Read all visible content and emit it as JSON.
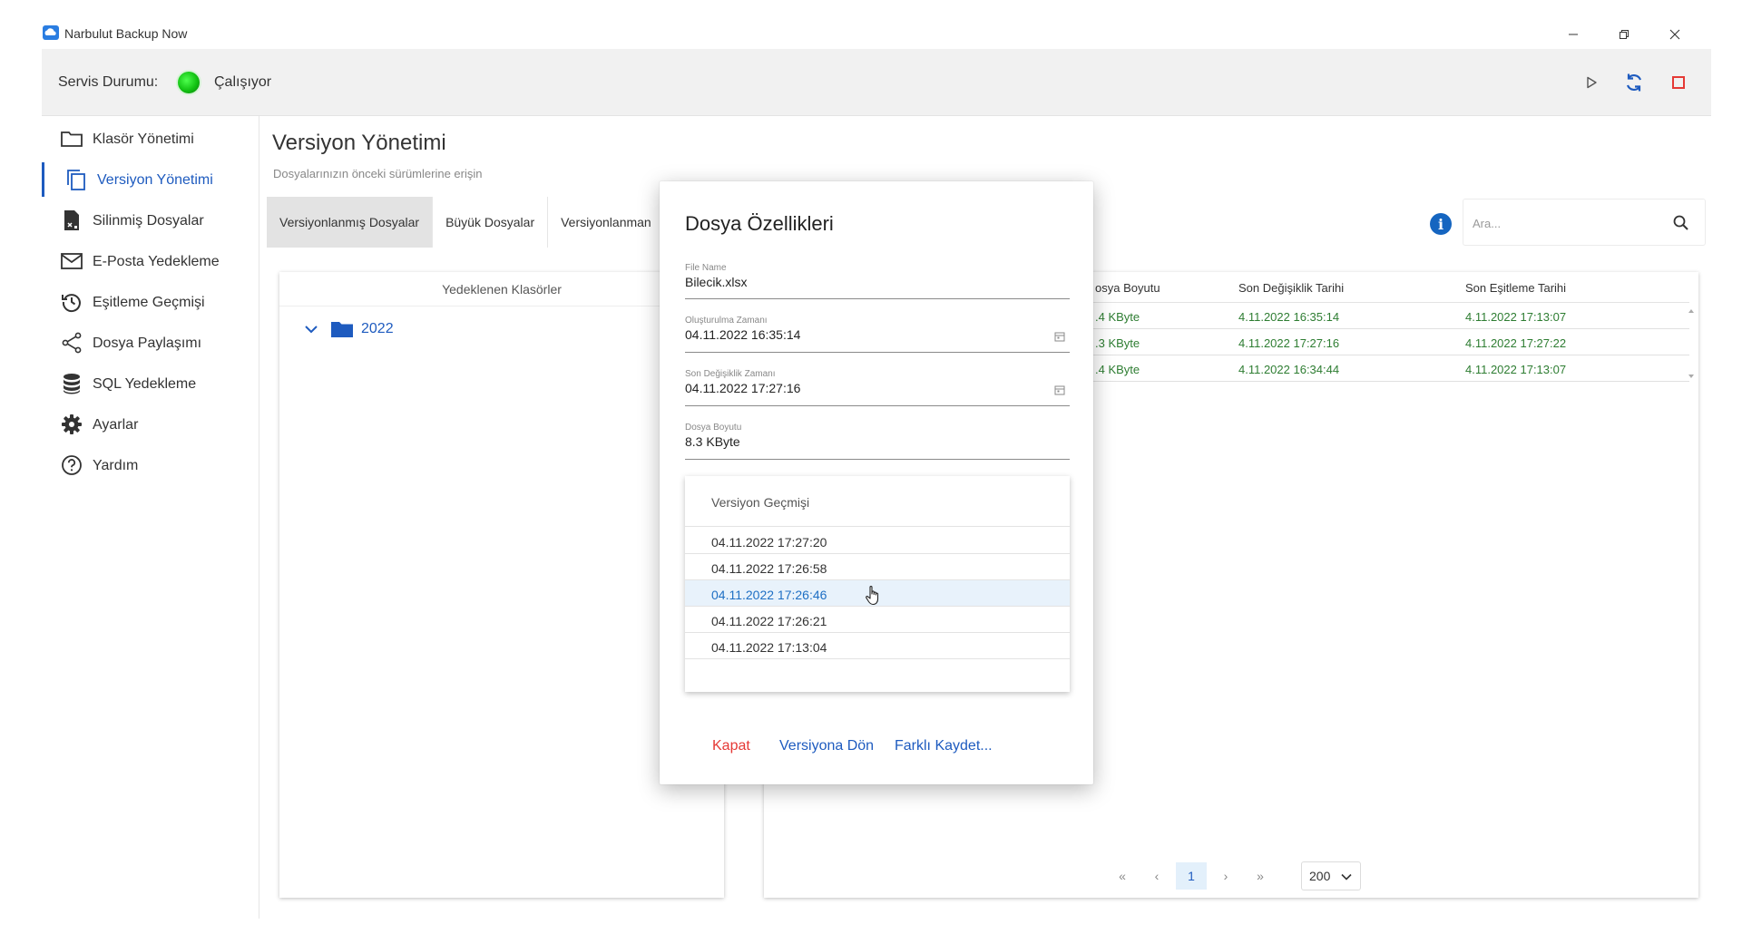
{
  "window": {
    "title": "Narbulut Backup Now",
    "logo_icon": "cloud-logo-icon",
    "controls": [
      "minimize-icon",
      "restore-icon",
      "close-icon"
    ]
  },
  "service": {
    "label": "Servis Durumu:",
    "status": "Çalışıyor",
    "status_color": "#12c212",
    "actions": [
      "play-icon",
      "sync-icon",
      "stop-icon"
    ]
  },
  "sidebar": {
    "items": [
      {
        "label": "Klasör Yönetimi",
        "icon": "folder-icon"
      },
      {
        "label": "Versiyon Yönetimi",
        "icon": "copy-icon",
        "active": true
      },
      {
        "label": "Silinmiş Dosyalar",
        "icon": "deleted-file-icon"
      },
      {
        "label": "E-Posta Yedekleme",
        "icon": "mail-icon"
      },
      {
        "label": "Eşitleme Geçmişi",
        "icon": "history-icon"
      },
      {
        "label": "Dosya Paylaşımı",
        "icon": "share-icon"
      },
      {
        "label": "SQL Yedekleme",
        "icon": "database-icon"
      },
      {
        "label": "Ayarlar",
        "icon": "gear-icon"
      },
      {
        "label": "Yardım",
        "icon": "help-icon"
      }
    ]
  },
  "page": {
    "title": "Versiyon Yönetimi",
    "subtitle": "Dosyalarınızın önceki sürümlerine erişin"
  },
  "tabs": [
    {
      "label": "Versiyonlanmış Dosyalar",
      "active": true
    },
    {
      "label": "Büyük Dosyalar"
    },
    {
      "label": "Versiyonlanman"
    }
  ],
  "search": {
    "placeholder": "Ara..."
  },
  "folders": {
    "header": "Yedeklenen Klasörler",
    "nodes": [
      {
        "label": "2022"
      }
    ]
  },
  "files": {
    "columns": {
      "size": "osya Boyutu",
      "modified": "Son Değişiklik Tarihi",
      "synced": "Son Eşitleme Tarihi"
    },
    "rows": [
      {
        "size": ".4 KByte",
        "modified": "4.11.2022 16:35:14",
        "synced": "4.11.2022 17:13:07"
      },
      {
        "size": ".3 KByte",
        "modified": "4.11.2022 17:27:16",
        "synced": "4.11.2022 17:27:22"
      },
      {
        "size": ".4 KByte",
        "modified": "4.11.2022 16:34:44",
        "synced": "4.11.2022 17:13:07"
      }
    ],
    "value_color": "#2e7d32"
  },
  "pagination": {
    "first": "«",
    "prev": "‹",
    "current": "1",
    "next": "›",
    "last": "»",
    "page_size": "200"
  },
  "dialog": {
    "title": "Dosya Özellikleri",
    "fields": {
      "file_name": {
        "label": "File Name",
        "value": "Bilecik.xlsx"
      },
      "created": {
        "label": "Oluşturulma Zamanı",
        "value": "04.11.2022 16:35:14"
      },
      "modified": {
        "label": "Son Değişiklik Zamanı",
        "value": "04.11.2022 17:27:16"
      },
      "size": {
        "label": "Dosya Boyutu",
        "value": "8.3 KByte"
      }
    },
    "history": {
      "title": "Versiyon Geçmişi",
      "items": [
        "04.11.2022 17:27:20",
        "04.11.2022 17:26:58",
        "04.11.2022 17:26:46",
        "04.11.2022 17:26:21",
        "04.11.2022 17:13:04"
      ],
      "hovered_index": 2
    },
    "buttons": {
      "close": "Kapat",
      "revert": "Versiyona Dön",
      "save_as": "Farklı Kaydet..."
    },
    "colors": {
      "close": "#e53935",
      "primary": "#1e5bbf"
    }
  }
}
